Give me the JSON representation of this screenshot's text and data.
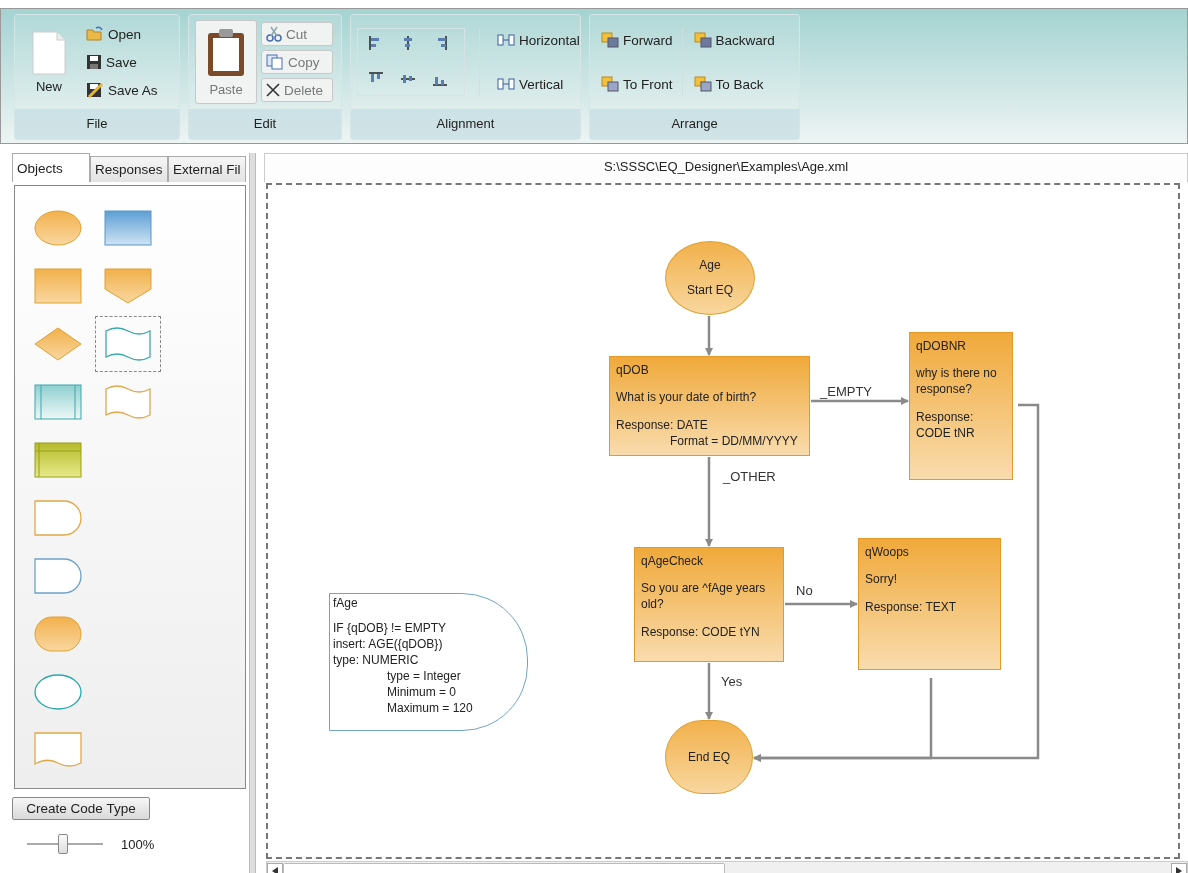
{
  "ribbon": {
    "groups": [
      {
        "label": "File",
        "buttons": [
          {
            "label": "New",
            "kind": "large",
            "disabled": false
          },
          {
            "label": "Open",
            "kind": "small",
            "disabled": false
          },
          {
            "label": "Save",
            "kind": "small",
            "disabled": false
          },
          {
            "label": "Save As",
            "kind": "small",
            "disabled": false
          }
        ]
      },
      {
        "label": "Edit",
        "buttons": [
          {
            "label": "Paste",
            "kind": "large",
            "disabled": true
          },
          {
            "label": "Cut",
            "kind": "small",
            "disabled": true
          },
          {
            "label": "Copy",
            "kind": "small",
            "disabled": true
          },
          {
            "label": "Delete",
            "kind": "small",
            "disabled": true
          }
        ]
      },
      {
        "label": "Alignment",
        "buttons": [
          {
            "label": "Horizontal",
            "kind": "small",
            "disabled": false
          },
          {
            "label": "Vertical",
            "kind": "small",
            "disabled": false
          }
        ]
      },
      {
        "label": "Arrange",
        "buttons": [
          {
            "label": "Forward",
            "kind": "small",
            "disabled": false
          },
          {
            "label": "To Front",
            "kind": "small",
            "disabled": false
          },
          {
            "label": "Backward",
            "kind": "small",
            "disabled": false
          },
          {
            "label": "To Back",
            "kind": "small",
            "disabled": false
          }
        ]
      }
    ]
  },
  "tabs": [
    {
      "label": "Objects",
      "selected": true
    },
    {
      "label": "Responses",
      "selected": false
    },
    {
      "label": "External Fil",
      "selected": false
    }
  ],
  "palette": [
    [
      {
        "kind": "ellipse",
        "selected": false
      },
      {
        "kind": "blue-rect",
        "selected": false
      }
    ],
    [
      {
        "kind": "rect",
        "selected": false
      },
      {
        "kind": "pentagon",
        "selected": false
      }
    ],
    [
      {
        "kind": "diamond",
        "selected": false
      },
      {
        "kind": "teal-wave",
        "selected": true
      }
    ],
    [
      {
        "kind": "process",
        "selected": false
      },
      {
        "kind": "wave",
        "selected": false
      }
    ],
    [
      {
        "kind": "table",
        "selected": false
      }
    ],
    [
      {
        "kind": "delay",
        "selected": false
      }
    ],
    [
      {
        "kind": "blue-delay",
        "selected": false
      }
    ],
    [
      {
        "kind": "stadium",
        "selected": false
      }
    ],
    [
      {
        "kind": "teal-ellipse",
        "selected": false
      }
    ],
    [
      {
        "kind": "document",
        "selected": false
      }
    ]
  ],
  "create_button": "Create Code Type",
  "zoom": {
    "level": 0.47,
    "reading": "100%"
  },
  "canvas": {
    "path": "S:\\SSSC\\EQ_Designer\\Examples\\Age.xml",
    "nodes": [
      {
        "kind": "start",
        "title": "Age",
        "paragraphs": [
          {
            "lines": [
              "Start EQ"
            ]
          }
        ]
      },
      {
        "kind": "question",
        "title": "qDOB",
        "paragraphs": [
          {
            "lines": [
              "What is your date of birth?"
            ]
          },
          {
            "lines": [
              "Response: DATE"
            ],
            "details": [
              "Format = DD/MM/YYYY"
            ]
          }
        ]
      },
      {
        "kind": "question",
        "title": "qDOBNR",
        "paragraphs": [
          {
            "lines": [
              "why is there no response?"
            ]
          },
          {
            "lines": [
              "Response: CODE tNR"
            ]
          }
        ]
      },
      {
        "kind": "question",
        "title": "qAgeCheck",
        "paragraphs": [
          {
            "lines": [
              "So you are ^fAge years old?"
            ]
          },
          {
            "lines": [
              "Response: CODE tYN"
            ]
          }
        ]
      },
      {
        "kind": "question",
        "title": "qWoops",
        "paragraphs": [
          {
            "lines": [
              "Sorry!"
            ]
          },
          {
            "lines": [
              "Response: TEXT"
            ]
          }
        ]
      },
      {
        "kind": "function",
        "title": "fAge",
        "paragraphs": [
          {
            "lines": [
              "IF {qDOB} != EMPTY",
              "insert: AGE({qDOB})",
              "type: NUMERIC"
            ],
            "details": [
              "type = Integer",
              "Minimum = 0",
              "Maximum = 120"
            ]
          }
        ]
      },
      {
        "kind": "end",
        "title": "End EQ"
      }
    ],
    "connector_labels": [
      "_EMPTY",
      "_OTHER",
      "No",
      "Yes"
    ]
  }
}
